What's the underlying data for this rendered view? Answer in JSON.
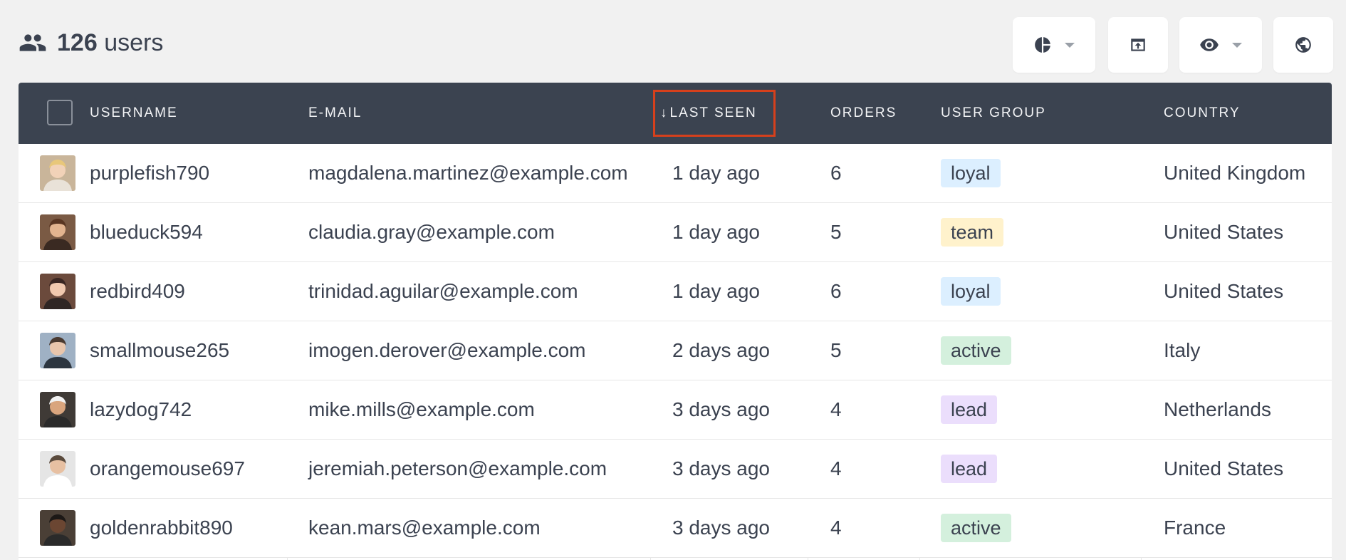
{
  "header": {
    "count": "126",
    "count_label": "users",
    "icons": {
      "users": "users-icon",
      "chart": "pie-chart-icon",
      "export": "export-icon",
      "view": "eye-icon",
      "globe": "globe-icon"
    }
  },
  "table": {
    "columns": {
      "username": "Username",
      "email": "E-mail",
      "last_seen": "Last seen",
      "last_seen_arrow": "↓",
      "orders": "Orders",
      "user_group": "User group",
      "country": "Country"
    },
    "rows": [
      {
        "username": "purplefish790",
        "email": "magdalena.martinez@example.com",
        "last_seen": "1 day ago",
        "orders": "6",
        "group": "loyal",
        "country": "United Kingdom"
      },
      {
        "username": "blueduck594",
        "email": "claudia.gray@example.com",
        "last_seen": "1 day ago",
        "orders": "5",
        "group": "team",
        "country": "United States"
      },
      {
        "username": "redbird409",
        "email": "trinidad.aguilar@example.com",
        "last_seen": "1 day ago",
        "orders": "6",
        "group": "loyal",
        "country": "United States"
      },
      {
        "username": "smallmouse265",
        "email": "imogen.derover@example.com",
        "last_seen": "2 days ago",
        "orders": "5",
        "group": "active",
        "country": "Italy"
      },
      {
        "username": "lazydog742",
        "email": "mike.mills@example.com",
        "last_seen": "3 days ago",
        "orders": "4",
        "group": "lead",
        "country": "Netherlands"
      },
      {
        "username": "orangemouse697",
        "email": "jeremiah.peterson@example.com",
        "last_seen": "3 days ago",
        "orders": "4",
        "group": "lead",
        "country": "United States"
      },
      {
        "username": "goldenrabbit890",
        "email": "kean.mars@example.com",
        "last_seen": "3 days ago",
        "orders": "4",
        "group": "active",
        "country": "France"
      }
    ]
  },
  "colors": {
    "header_bg": "#3b4350",
    "sort_highlight": "#d6401c",
    "loyal": "#dcefff",
    "team": "#fff2cc",
    "active": "#d4f0dd",
    "lead": "#ebdefc"
  }
}
